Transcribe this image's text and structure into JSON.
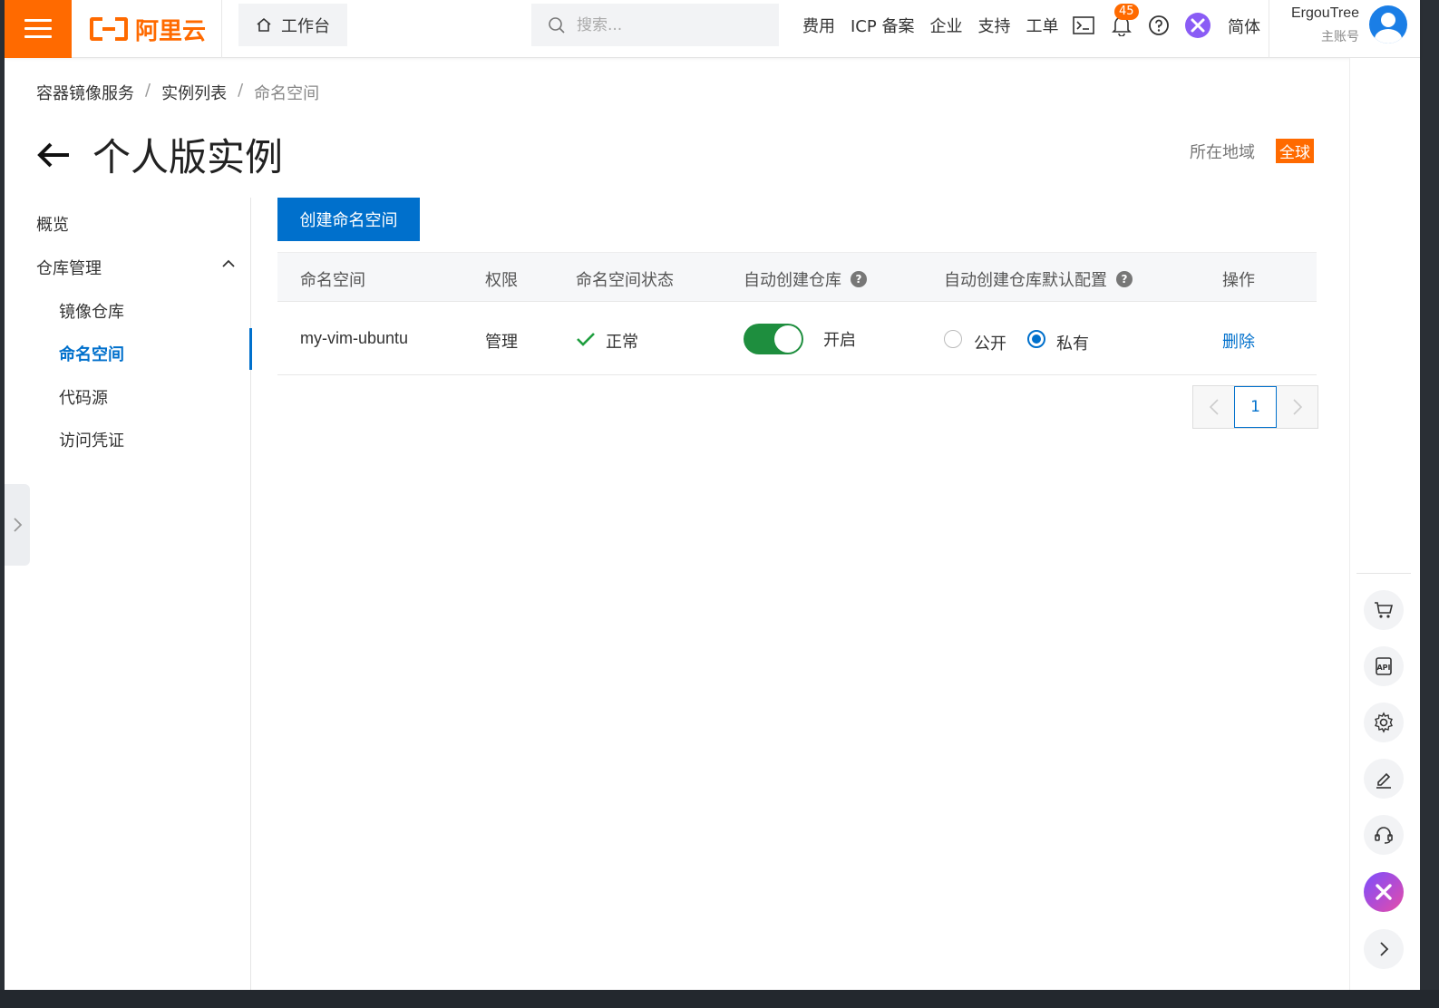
{
  "header": {
    "logo_text": "阿里云",
    "workbench_label": "工作台",
    "search_placeholder": "搜索...",
    "nav_links": [
      "费用",
      "ICP 备案",
      "企业",
      "支持",
      "工单"
    ],
    "notification_count": "45",
    "language": "简体",
    "user_name": "ErgouTree",
    "user_role": "主账号"
  },
  "breadcrumb": [
    "容器镜像服务",
    "实例列表",
    "命名空间"
  ],
  "page": {
    "title": "个人版实例",
    "region_label": "所在地域",
    "region_value": "全球"
  },
  "sidebar": {
    "items": [
      {
        "label": "概览"
      },
      {
        "label": "仓库管理"
      },
      {
        "label": "镜像仓库"
      },
      {
        "label": "命名空间"
      },
      {
        "label": "代码源"
      },
      {
        "label": "访问凭证"
      }
    ],
    "active": "命名空间"
  },
  "main": {
    "create_button": "创建命名空间",
    "columns": [
      "命名空间",
      "权限",
      "命名空间状态",
      "自动创建仓库",
      "自动创建仓库默认配置",
      "操作"
    ],
    "rows": [
      {
        "namespace": "my-vim-ubuntu",
        "permission": "管理",
        "status": "正常",
        "auto_create": "开启",
        "auto_create_on": true,
        "visibility_options": [
          "公开",
          "私有"
        ],
        "visibility_selected": "私有",
        "action": "删除"
      }
    ],
    "pagination": {
      "current_page": "1"
    }
  },
  "colors": {
    "brand": "#ff6a00",
    "primary": "#0070cc",
    "toggle_on": "#1e8e3e",
    "status_ok": "#1e9e3e"
  }
}
